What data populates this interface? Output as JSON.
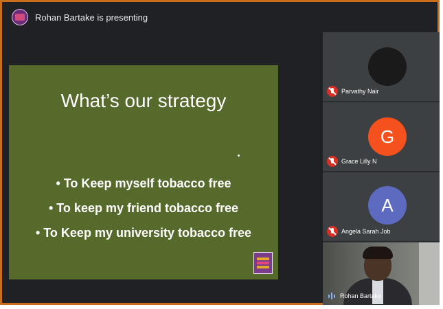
{
  "meeting": {
    "presenting_text": "Rohan Bartake is presenting",
    "accent_border": "#c96e1c"
  },
  "slide": {
    "title": "What’s our strategy",
    "bullets": [
      "• To Keep myself tobacco free",
      "• To keep my friend tobacco free",
      "• To Keep my university tobacco free"
    ],
    "background": "#566a2b",
    "logo_icon": "cancer-society-logo"
  },
  "participants": [
    {
      "name": "Parvathy Nair",
      "initial": "",
      "avatar_color": "#1a1a1a",
      "muted": true
    },
    {
      "name": "Grace Lilly N",
      "initial": "G",
      "avatar_color": "#f4511e",
      "muted": true
    },
    {
      "name": "Angela Sarah Job",
      "initial": "A",
      "avatar_color": "#5c6bc0",
      "muted": true
    },
    {
      "name": "Rohan Bartake",
      "initial": "",
      "avatar_color": "",
      "muted": false,
      "video": true
    }
  ]
}
